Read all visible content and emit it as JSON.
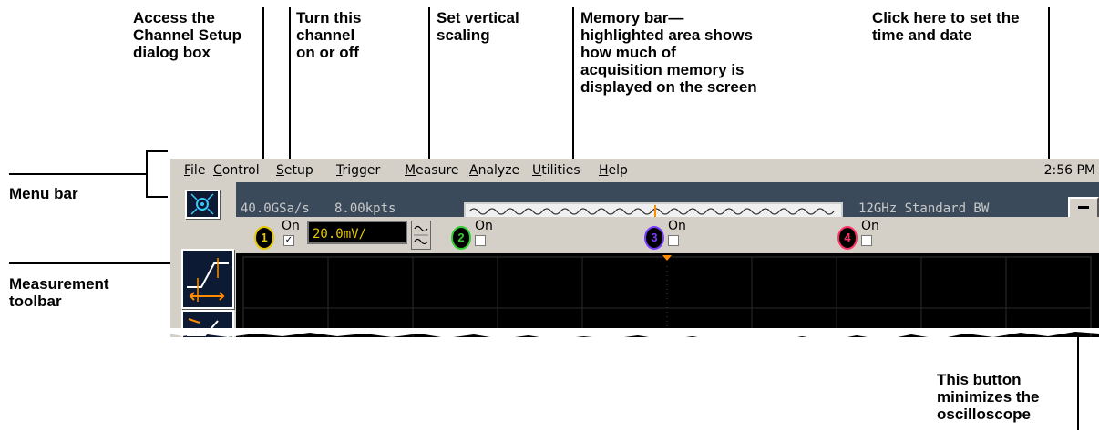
{
  "callouts": {
    "channel_setup": [
      "Access the",
      "Channel Setup",
      "dialog box"
    ],
    "channel_toggle": [
      "Turn this",
      "channel",
      "on or off"
    ],
    "vertical_scaling": [
      "Set vertical",
      "scaling"
    ],
    "memory_bar": [
      "Memory bar—",
      "highlighted area shows",
      "how much of",
      "acquisition memory is",
      "displayed on the screen"
    ],
    "time_date": [
      "Click here to set the",
      "time and date"
    ],
    "menu_bar": "Menu bar",
    "measurement_toolbar": [
      "Measurement",
      "toolbar"
    ],
    "minimize": [
      "This button",
      "minimizes the",
      "oscilloscope"
    ]
  },
  "menu": {
    "items": [
      {
        "ul": "F",
        "rest": "ile"
      },
      {
        "ul": "C",
        "rest": "ontrol"
      },
      {
        "ul": "S",
        "rest": "etup"
      },
      {
        "ul": "T",
        "rest": "rigger"
      },
      {
        "ul": "M",
        "rest": "easure"
      },
      {
        "ul": "A",
        "rest": "nalyze"
      },
      {
        "ul": "U",
        "rest": "tilities"
      },
      {
        "ul": "H",
        "rest": "elp"
      }
    ],
    "clock": "2:56 PM"
  },
  "status": {
    "sample_rate": "40.0GSa/s",
    "memory_depth": "8.00kpts",
    "bandwidth": "12GHz Standard BW"
  },
  "channels": [
    {
      "number": "1",
      "label": "On",
      "checked": "✓",
      "color": "#e6c800",
      "scale": "20.0mV/"
    },
    {
      "number": "2",
      "label": "On",
      "checked": "",
      "color": "#33cc33"
    },
    {
      "number": "3",
      "label": "On",
      "checked": "",
      "color": "#7a3cff"
    },
    {
      "number": "4",
      "label": "On",
      "checked": "",
      "color": "#ff3366"
    }
  ],
  "icons": {
    "setup": "channel-setup-icon",
    "measure": "measurement-icon",
    "spin": "scale-spinner-icon",
    "minimize": "minimize-icon"
  },
  "colors": {
    "status_bg": "#3a4a5a",
    "menu_bg": "#d4d0c8",
    "trigger_marker": "#ff8c00"
  }
}
